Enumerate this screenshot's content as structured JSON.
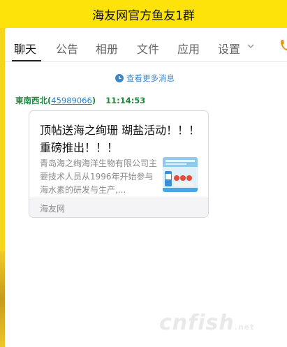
{
  "window": {
    "title": "海友网官方鱼友1群"
  },
  "tabs": [
    {
      "label": "聊天",
      "active": true
    },
    {
      "label": "公告"
    },
    {
      "label": "相册"
    },
    {
      "label": "文件"
    },
    {
      "label": "应用"
    },
    {
      "label": "设置"
    }
  ],
  "chat": {
    "view_more_label": "查看更多消息",
    "message": {
      "sender_name": "東南西北",
      "sender_open_paren": "(",
      "sender_qq": "45989066",
      "sender_close_paren": ")",
      "time": "11:14:53",
      "card": {
        "title": "顶帖送海之绚珊 瑚盐活动！！！ 重磅推出！！！",
        "description": "青岛海之绚海洋生物有限公司主要技术人员从1996年开始参与海水素的研发与生产,...",
        "source": "海友网"
      }
    }
  },
  "watermark": {
    "text": "cnfish",
    "suffix": ".net"
  },
  "colors": {
    "titlebar_bg": "#fde30a",
    "page_bg": "#f7d51d",
    "link_blue": "#3d87c9",
    "sender_green": "#1d8a3d",
    "phone_orange": "#e79a1c"
  },
  "icons": {
    "view_more": "clock-arrow-icon",
    "settings_dropdown": "chevron-down-icon",
    "call": "phone-icon"
  }
}
